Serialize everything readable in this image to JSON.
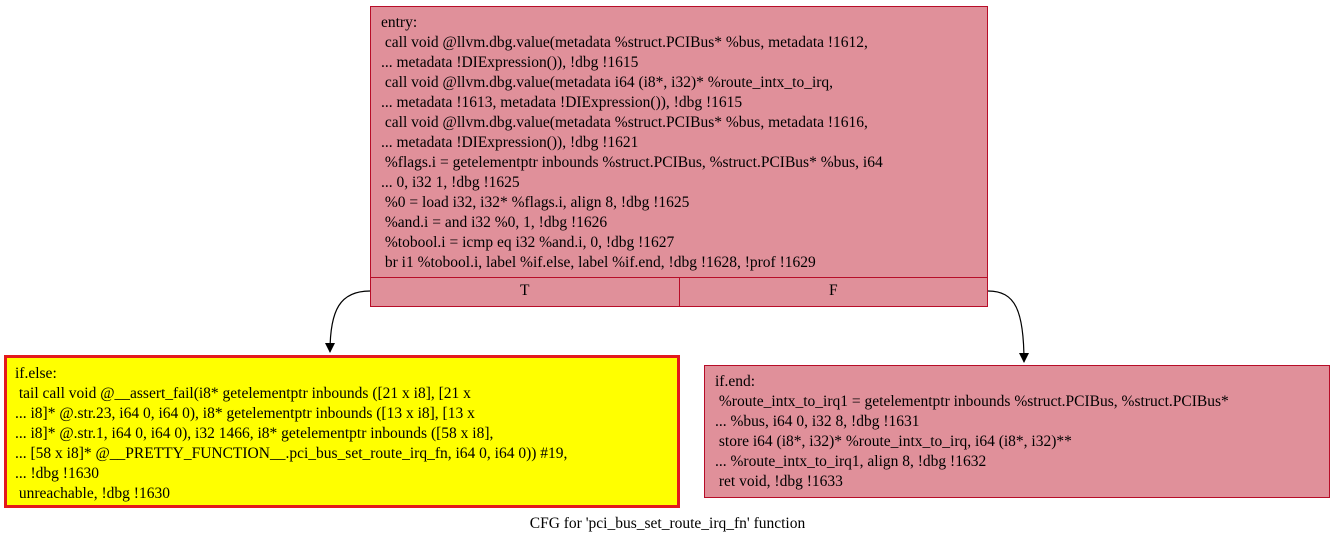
{
  "graph": {
    "caption": "CFG for 'pci_bus_set_route_irq_fn' function",
    "nodes": {
      "entry": {
        "lines": [
          "entry:",
          " call void @llvm.dbg.value(metadata %struct.PCIBus* %bus, metadata !1612,",
          "... metadata !DIExpression()), !dbg !1615",
          " call void @llvm.dbg.value(metadata i64 (i8*, i32)* %route_intx_to_irq,",
          "... metadata !1613, metadata !DIExpression()), !dbg !1615",
          " call void @llvm.dbg.value(metadata %struct.PCIBus* %bus, metadata !1616,",
          "... metadata !DIExpression()), !dbg !1621",
          " %flags.i = getelementptr inbounds %struct.PCIBus, %struct.PCIBus* %bus, i64",
          "... 0, i32 1, !dbg !1625",
          " %0 = load i32, i32* %flags.i, align 8, !dbg !1625",
          " %and.i = and i32 %0, 1, !dbg !1626",
          " %tobool.i = icmp eq i32 %and.i, 0, !dbg !1627",
          " br i1 %tobool.i, label %if.else, label %if.end, !dbg !1628, !prof !1629"
        ],
        "ports": [
          "T",
          "F"
        ],
        "fill": "#e0909a",
        "stroke": "#b70d28"
      },
      "if_else": {
        "lines": [
          "if.else:",
          " tail call void @__assert_fail(i8* getelementptr inbounds ([21 x i8], [21 x",
          "... i8]* @.str.23, i64 0, i64 0), i8* getelementptr inbounds ([13 x i8], [13 x",
          "... i8]* @.str.1, i64 0, i64 0), i32 1466, i8* getelementptr inbounds ([58 x i8],",
          "... [58 x i8]* @__PRETTY_FUNCTION__.pci_bus_set_route_irq_fn, i64 0, i64 0)) #19,",
          "... !dbg !1630",
          " unreachable, !dbg !1630"
        ],
        "fill": "#ffff00",
        "stroke": "#e31a1c"
      },
      "if_end": {
        "lines": [
          "if.end:",
          " %route_intx_to_irq1 = getelementptr inbounds %struct.PCIBus, %struct.PCIBus*",
          "... %bus, i64 0, i32 8, !dbg !1631",
          " store i64 (i8*, i32)* %route_intx_to_irq, i64 (i8*, i32)**",
          "... %route_intx_to_irq1, align 8, !dbg !1632",
          " ret void, !dbg !1633"
        ],
        "fill": "#e0909a",
        "stroke": "#b70d28"
      }
    },
    "edges": [
      {
        "from": "entry",
        "port": "T",
        "to": "if_else"
      },
      {
        "from": "entry",
        "port": "F",
        "to": "if_end"
      }
    ]
  }
}
